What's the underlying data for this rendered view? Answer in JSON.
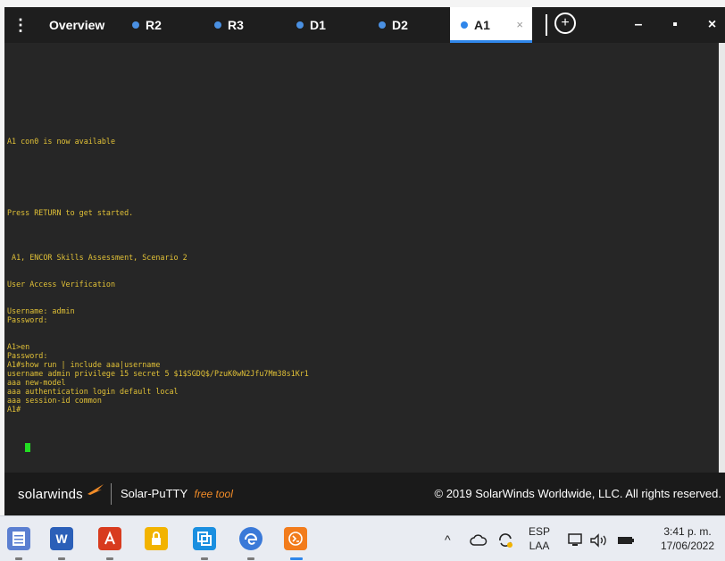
{
  "tabbar": {
    "tabs": [
      {
        "label": "Overview"
      },
      {
        "label": "R2"
      },
      {
        "label": "R3"
      },
      {
        "label": "D1"
      },
      {
        "label": "D2"
      },
      {
        "label": "A1"
      }
    ],
    "active_tab": "A1",
    "close_glyph": "×",
    "menu_glyph": "⋮",
    "add_glyph": "+",
    "minimize_glyph": "–",
    "maximize_glyph": "▪",
    "close_window_glyph": "×"
  },
  "terminal": {
    "lines": [
      "A1 con0 is now available",
      "",
      "",
      "",
      "",
      "",
      "",
      "",
      "Press RETURN to get started.",
      "",
      "",
      "",
      "",
      " A1, ENCOR Skills Assessment, Scenario 2",
      "",
      "",
      "User Access Verification",
      "",
      "",
      "Username: admin",
      "Password:",
      "",
      "",
      "A1>en",
      "Password:",
      "A1#show run | include aaa|username",
      "username admin privilege 15 secret 5 $1$SGDQ$/PzuK0wN2Jfu7Mm38s1Kr1",
      "aaa new-model",
      "aaa authentication login default local",
      "aaa session-id common",
      "A1#"
    ]
  },
  "footer": {
    "brand": "solarwinds",
    "app_name": "Solar-PuTTY",
    "app_tag": "free tool",
    "copyright": "© 2019 SolarWinds Worldwide, LLC. All rights reserved."
  },
  "taskbar": {
    "apps": [
      {
        "icon": "notepad-icon"
      },
      {
        "icon": "word-icon",
        "letter": "W"
      },
      {
        "icon": "acrobat-icon"
      },
      {
        "icon": "lock-app-icon"
      },
      {
        "icon": "copy-app-icon"
      },
      {
        "icon": "edge-icon"
      },
      {
        "icon": "solar-putty-icon"
      }
    ],
    "tray": {
      "language": "ESP",
      "layout": "LAA",
      "time": "3:41 p. m.",
      "date": "17/06/2022"
    }
  },
  "colors": {
    "terminal_bg": "#262626",
    "terminal_text": "#e0c037",
    "cursor": "#22dd22",
    "accent": "#2f86ea",
    "tabbar_bg": "#1e1e1e",
    "footer_bg": "#1a1a1a",
    "free_tool": "#f28c28"
  }
}
